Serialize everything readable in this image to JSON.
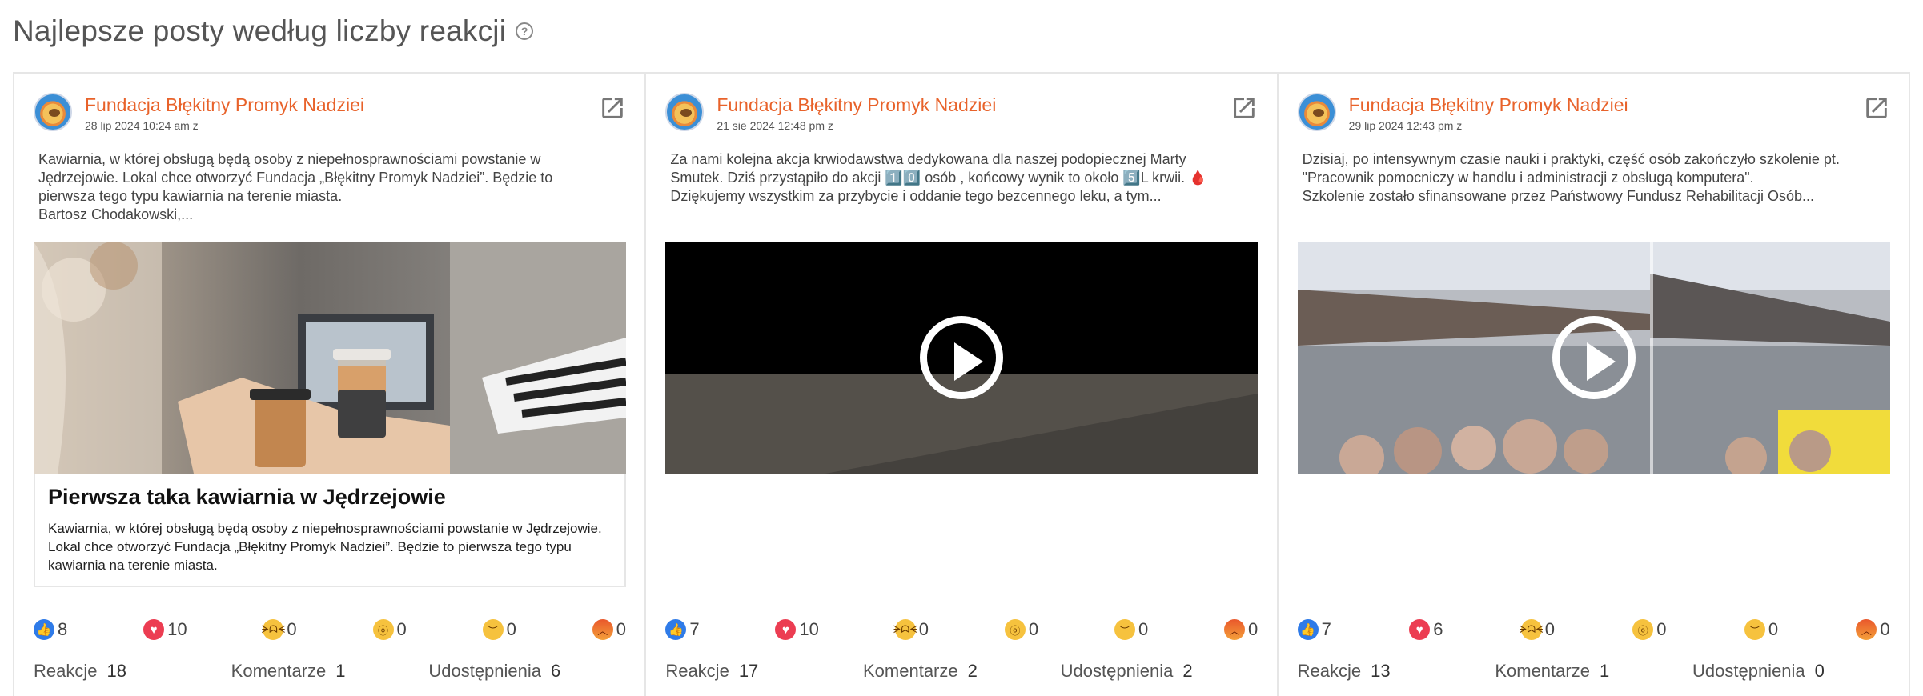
{
  "header": {
    "title": "Najlepsze posty według liczby reakcji",
    "help_icon": "question-circle-icon"
  },
  "cards": [
    {
      "author": "Fundacja Błękitny Promyk Nadziei",
      "date": "28 lip 2024 10:24 am z",
      "text": [
        "Kawiarnia, w której obsługą będą osoby z niepełnosprawnościami powstanie w",
        "Jędrzejowie. Lokal chce otworzyć Fundacja „Błękitny Promyk Nadziei”. Będzie to",
        "pierwsza tego typu kawiarnia na terenie miasta.",
        "Bartosz Chodakowski,..."
      ],
      "media_type": "photo",
      "link_title": "Pierwsza taka kawiarnia w Jędrzejowie",
      "link_desc": [
        "Kawiarnia, w której obsługą będą osoby z niepełnosprawnościami powstanie w Jędrzejowie.",
        "Lokal chce otworzyć Fundacja „Błękitny Promyk Nadziei”. Będzie to pierwsza tego typu",
        "kawiarnia na terenie miasta."
      ],
      "reactions": {
        "like": "8",
        "love": "10",
        "haha": "0",
        "wow": "0",
        "sad": "0",
        "angry": "0"
      },
      "stats": {
        "reactions_label": "Reakcje",
        "reactions": "18",
        "comments_label": "Komentarze",
        "comments": "1",
        "shares_label": "Udostępnienia",
        "shares": "6"
      }
    },
    {
      "author": "Fundacja Błękitny Promyk Nadziei",
      "date": "21 sie 2024 12:48 pm z",
      "text": [
        "Za nami kolejna akcja krwiodawstwa dedykowana dla naszej podopiecznej Marty",
        "Smutek. Dziś przystąpiło do akcji 1️⃣0️⃣ osób , końcowy wynik to około 5️⃣L krwii. 🩸",
        "Dziękujemy wszystkim za przybycie i oddanie tego bezcennego leku, a tym..."
      ],
      "media_type": "video",
      "reactions": {
        "like": "7",
        "love": "10",
        "haha": "0",
        "wow": "0",
        "sad": "0",
        "angry": "0"
      },
      "stats": {
        "reactions_label": "Reakcje",
        "reactions": "17",
        "comments_label": "Komentarze",
        "comments": "2",
        "shares_label": "Udostępnienia",
        "shares": "2"
      }
    },
    {
      "author": "Fundacja Błękitny Promyk Nadziei",
      "date": "29 lip 2024 12:43 pm z",
      "text": [
        "Dzisiaj, po intensywnym czasie nauki i praktyki, część osób zakończyło szkolenie pt.",
        "\"Pracownik pomocniczy w handlu i administracji z obsługą komputera\".",
        "Szkolenie zostało sfinansowane przez Państwowy Fundusz Rehabilitacji Osób..."
      ],
      "media_type": "video",
      "reactions": {
        "like": "7",
        "love": "6",
        "haha": "0",
        "wow": "0",
        "sad": "0",
        "angry": "0"
      },
      "stats": {
        "reactions_label": "Reakcje",
        "reactions": "13",
        "comments_label": "Komentarze",
        "comments": "1",
        "shares_label": "Udostępnienia",
        "shares": "0"
      }
    }
  ],
  "colors": {
    "author": "#e8622a",
    "like": "#2f7be8",
    "love": "#ec3d52",
    "face": "#f6c23e"
  }
}
